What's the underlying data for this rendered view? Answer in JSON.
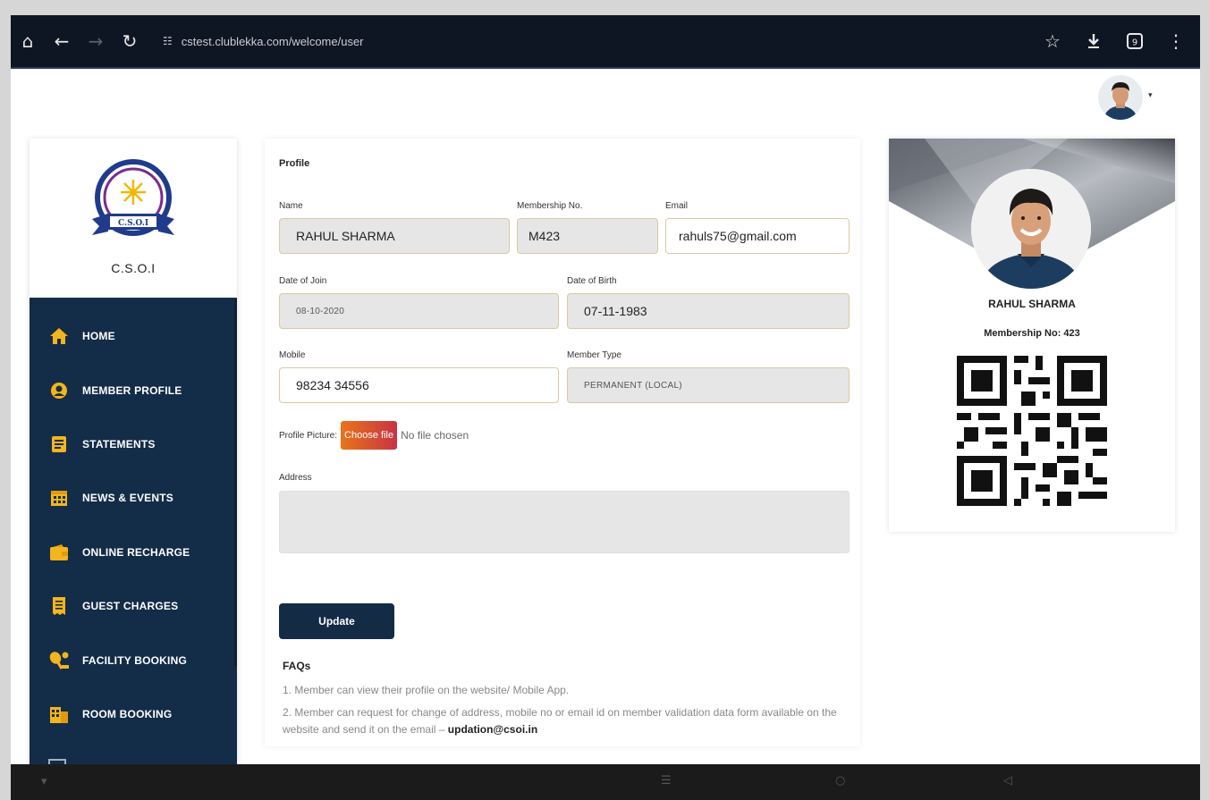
{
  "browser": {
    "url": "cstest.clublekka.com/welcome/user",
    "icons": [
      "home-icon",
      "back-icon",
      "forward-icon",
      "reload-icon",
      "site-settings-icon",
      "star-icon",
      "download-icon",
      "tabs-icon",
      "menu-icon"
    ],
    "tab_count": "9"
  },
  "sidebar": {
    "brand": "C.S.O.I",
    "logo_text": "C.S.O.I",
    "items": [
      {
        "label": "HOME",
        "icon": "home-icon"
      },
      {
        "label": "MEMBER PROFILE",
        "icon": "user-circle-icon"
      },
      {
        "label": "STATEMENTS",
        "icon": "document-icon"
      },
      {
        "label": "NEWS & EVENTS",
        "icon": "calendar-icon"
      },
      {
        "label": "ONLINE RECHARGE",
        "icon": "wallet-icon"
      },
      {
        "label": "GUEST CHARGES",
        "icon": "receipt-icon"
      },
      {
        "label": "FACILITY BOOKING",
        "icon": "tennis-icon"
      },
      {
        "label": "ROOM BOOKING",
        "icon": "room-icon"
      }
    ]
  },
  "profile": {
    "title": "Profile",
    "name_label": "Name",
    "name": "RAHUL SHARMA",
    "membership_label": "Membership No.",
    "membership": "M423",
    "email_label": "Email",
    "email": "rahuls75@gmail.com",
    "doj_label": "Date of Join",
    "doj": "08-10-2020",
    "dob_label": "Date of Birth",
    "dob": "07-11-1983",
    "mobile_label": "Mobile",
    "mobile": "98234 34556",
    "member_type_label": "Member Type",
    "member_type": "PERMANENT (LOCAL)",
    "picture_label": "Profile Picture:",
    "choose_file": "Choose file",
    "no_file": "No file chosen",
    "address_label": "Address",
    "address": "",
    "update_label": "Update"
  },
  "faqs": {
    "title": "FAQs",
    "item1": "1. Member can view their profile on the website/ Mobile App.",
    "item2_prefix": "2. Member can request for change of address, mobile no or email id on member validation data form available on the website and send it on the email – ",
    "item2_email": "updation@csoi.in"
  },
  "id_card": {
    "name": "RAHUL SHARMA",
    "membership": "Membership No: 423"
  },
  "colors": {
    "sidebar": "#132c48",
    "browser": "#0f1623",
    "button": "#142b46",
    "field_border": "#d8c9a3"
  }
}
